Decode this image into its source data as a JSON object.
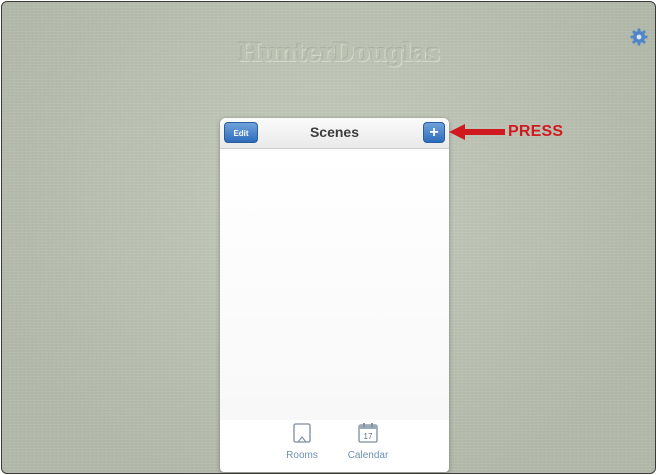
{
  "background": {
    "brand_logo": "HunterDouglas",
    "colors": {
      "background": "#bfc7b6",
      "accent_blue": "#3a78c6",
      "callout_red": "#d11a20"
    }
  },
  "settings": {
    "icon": "gear-icon"
  },
  "panel": {
    "title": "Scenes",
    "edit_label": "Edit",
    "add_label": "+"
  },
  "tabbar": {
    "items": [
      {
        "label": "Rooms",
        "icon": "rooms-icon"
      },
      {
        "label": "Calendar",
        "icon": "calendar-icon",
        "date": "17"
      }
    ]
  },
  "annotation": {
    "text": "PRESS",
    "icon": "arrow-left-icon"
  }
}
